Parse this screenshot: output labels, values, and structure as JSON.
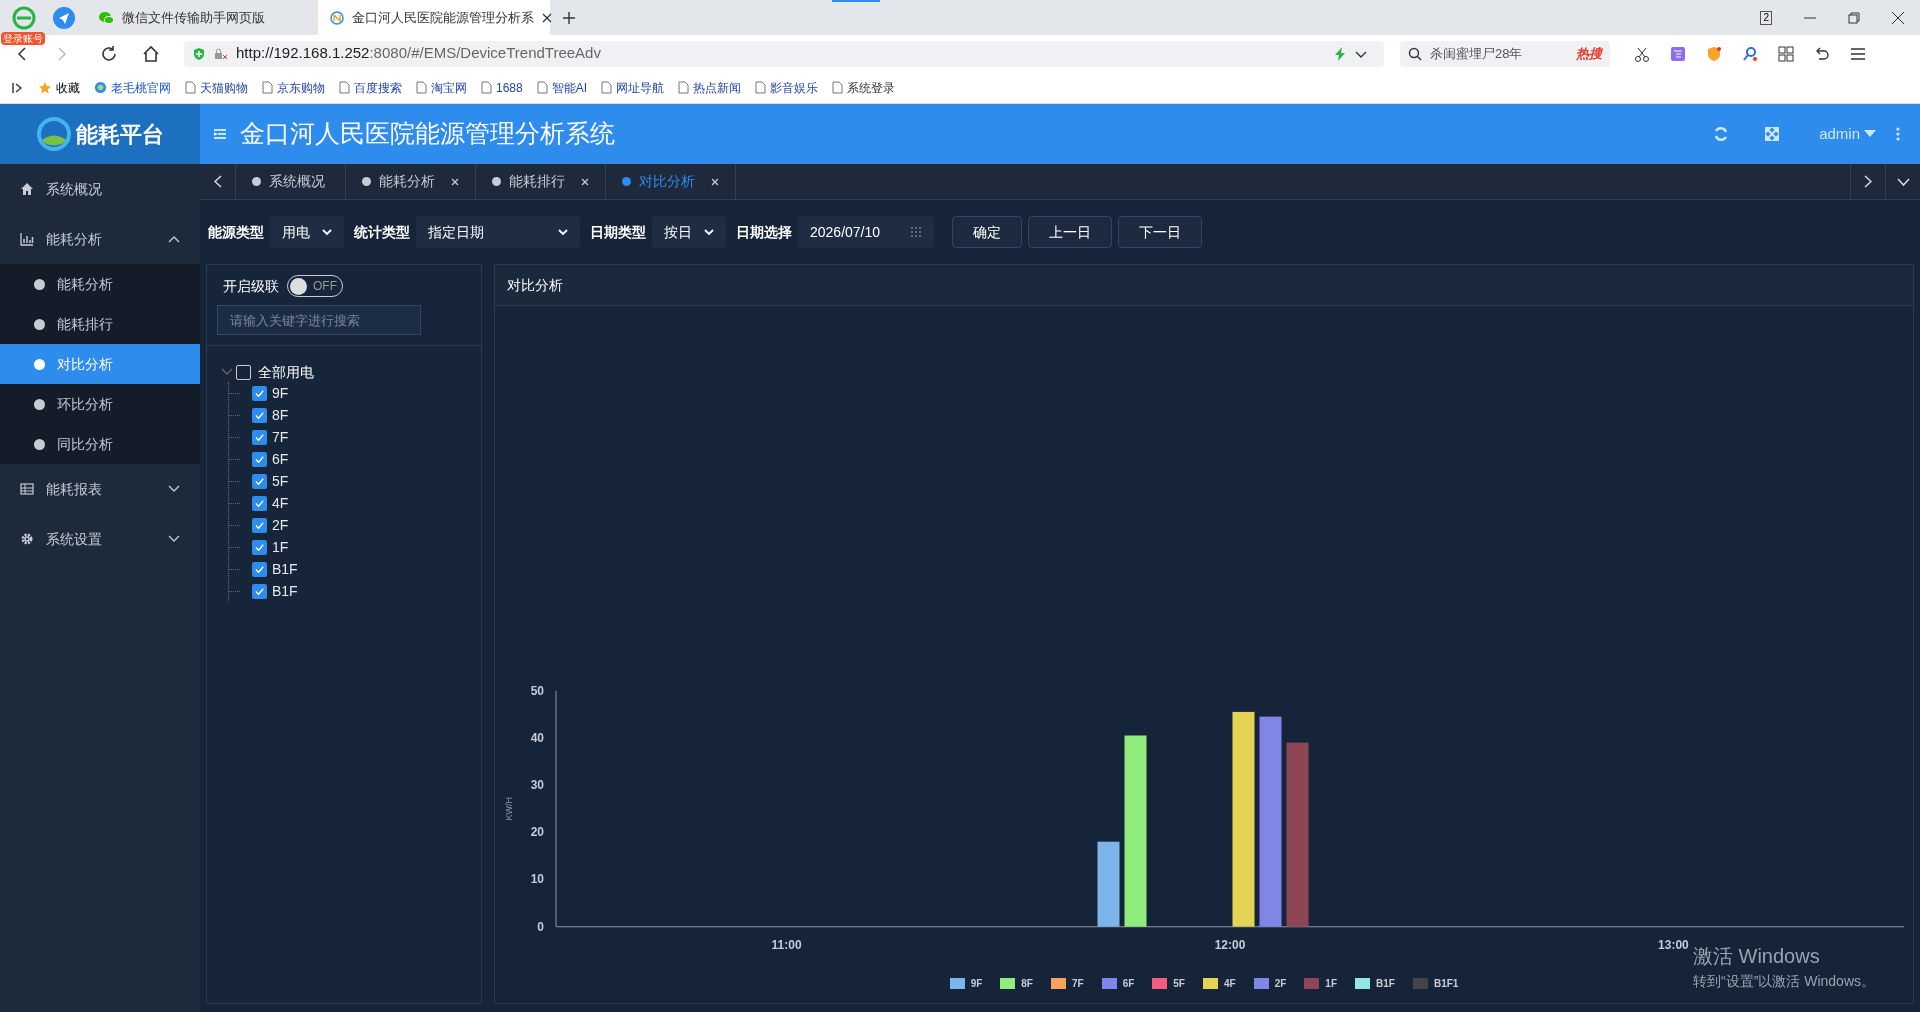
{
  "browser": {
    "badge": "登录账号",
    "tabs": [
      {
        "title": "微信文件传输助手网页版",
        "selected": false
      },
      {
        "title": "金口河人民医院能源管理分析系",
        "selected": true
      }
    ],
    "window_count": "2",
    "url_host": "http://192.168.1.252",
    "url_rest": ":8080/#/EMS/DeviceTrendTreeAdv",
    "search_text": "杀闺蜜埋尸28年",
    "hot_label": "热搜",
    "bookmarks_label": "收藏",
    "bookmarks": [
      "老毛桃官网",
      "天猫购物",
      "京东购物",
      "百度搜索",
      "淘宝网",
      "1688",
      "智能AI",
      "网址导航",
      "热点新闻",
      "影音娱乐",
      "系统登录"
    ]
  },
  "app": {
    "logo": "能耗平台",
    "title": "金口河人民医院能源管理分析系统",
    "user": "admin"
  },
  "sidebar": [
    {
      "label": "系统概况"
    },
    {
      "label": "能耗分析",
      "expanded": true,
      "children": [
        {
          "label": "能耗分析",
          "selected": false
        },
        {
          "label": "能耗排行",
          "selected": false
        },
        {
          "label": "对比分析",
          "selected": true
        },
        {
          "label": "环比分析",
          "selected": false
        },
        {
          "label": "同比分析",
          "selected": false
        }
      ]
    },
    {
      "label": "能耗报表",
      "expanded": false
    },
    {
      "label": "系统设置",
      "expanded": false
    }
  ],
  "page_tabs": [
    {
      "label": "系统概况",
      "closable": false,
      "selected": false
    },
    {
      "label": "能耗分析",
      "closable": true,
      "selected": false
    },
    {
      "label": "能耗排行",
      "closable": true,
      "selected": false
    },
    {
      "label": "对比分析",
      "closable": true,
      "selected": true
    }
  ],
  "filters": [
    {
      "label": "能源类型",
      "value": "用电",
      "kind": "select"
    },
    {
      "label": "统计类型",
      "value": "指定日期",
      "kind": "select"
    },
    {
      "label": "日期类型",
      "value": "按日",
      "kind": "select"
    },
    {
      "label": "日期选择",
      "value": "2026/07/10",
      "kind": "date"
    }
  ],
  "actions": [
    "确定",
    "上一日",
    "下一日"
  ],
  "tree_panel": {
    "cascade_label": "开启级联",
    "cascade_on": false,
    "switch_text": "OFF",
    "search_placeholder": "请输入关键字进行搜索",
    "root": {
      "label": "全部用电",
      "checked": false,
      "expanded": true,
      "children": [
        {
          "label": "9F",
          "checked": true
        },
        {
          "label": "8F",
          "checked": true
        },
        {
          "label": "7F",
          "checked": true
        },
        {
          "label": "6F",
          "checked": true
        },
        {
          "label": "5F",
          "checked": true
        },
        {
          "label": "4F",
          "checked": true
        },
        {
          "label": "2F",
          "checked": true
        },
        {
          "label": "1F",
          "checked": true
        },
        {
          "label": "B1F",
          "checked": true
        },
        {
          "label": "B1F",
          "checked": true
        }
      ]
    }
  },
  "chart_panel": {
    "title": "对比分析",
    "chart_data": {
      "type": "bar",
      "ylabel": "KW/H",
      "categories": [
        "11:00",
        "12:00",
        "13:00"
      ],
      "legend": "bottom",
      "ylim": [
        0,
        50
      ],
      "yticks": [
        0,
        10,
        20,
        30,
        40,
        50
      ],
      "series": [
        {
          "name": "9F",
          "color": "#7cb5ec",
          "values": [
            null,
            18,
            null
          ]
        },
        {
          "name": "8F",
          "color": "#90ed7d",
          "values": [
            null,
            40.5,
            null
          ]
        },
        {
          "name": "7F",
          "color": "#f7a35c",
          "values": [
            null,
            null,
            null
          ]
        },
        {
          "name": "6F",
          "color": "#8085e9",
          "values": [
            null,
            null,
            null
          ]
        },
        {
          "name": "5F",
          "color": "#f15c80",
          "values": [
            null,
            null,
            null
          ]
        },
        {
          "name": "4F",
          "color": "#e4d354",
          "values": [
            null,
            45.5,
            null
          ]
        },
        {
          "name": "2F",
          "color": "#8085e8",
          "values": [
            null,
            44.5,
            null
          ]
        },
        {
          "name": "1F",
          "color": "#8d4653",
          "values": [
            null,
            39,
            null
          ]
        },
        {
          "name": "B1F",
          "color": "#91e8e1",
          "values": [
            null,
            null,
            null
          ]
        },
        {
          "name": "B1F1",
          "color": "#434348",
          "values": [
            null,
            null,
            null
          ]
        }
      ]
    }
  },
  "os_notice": {
    "title": "激活 Windows",
    "text": "转到“设置”以激活 Windows。"
  }
}
